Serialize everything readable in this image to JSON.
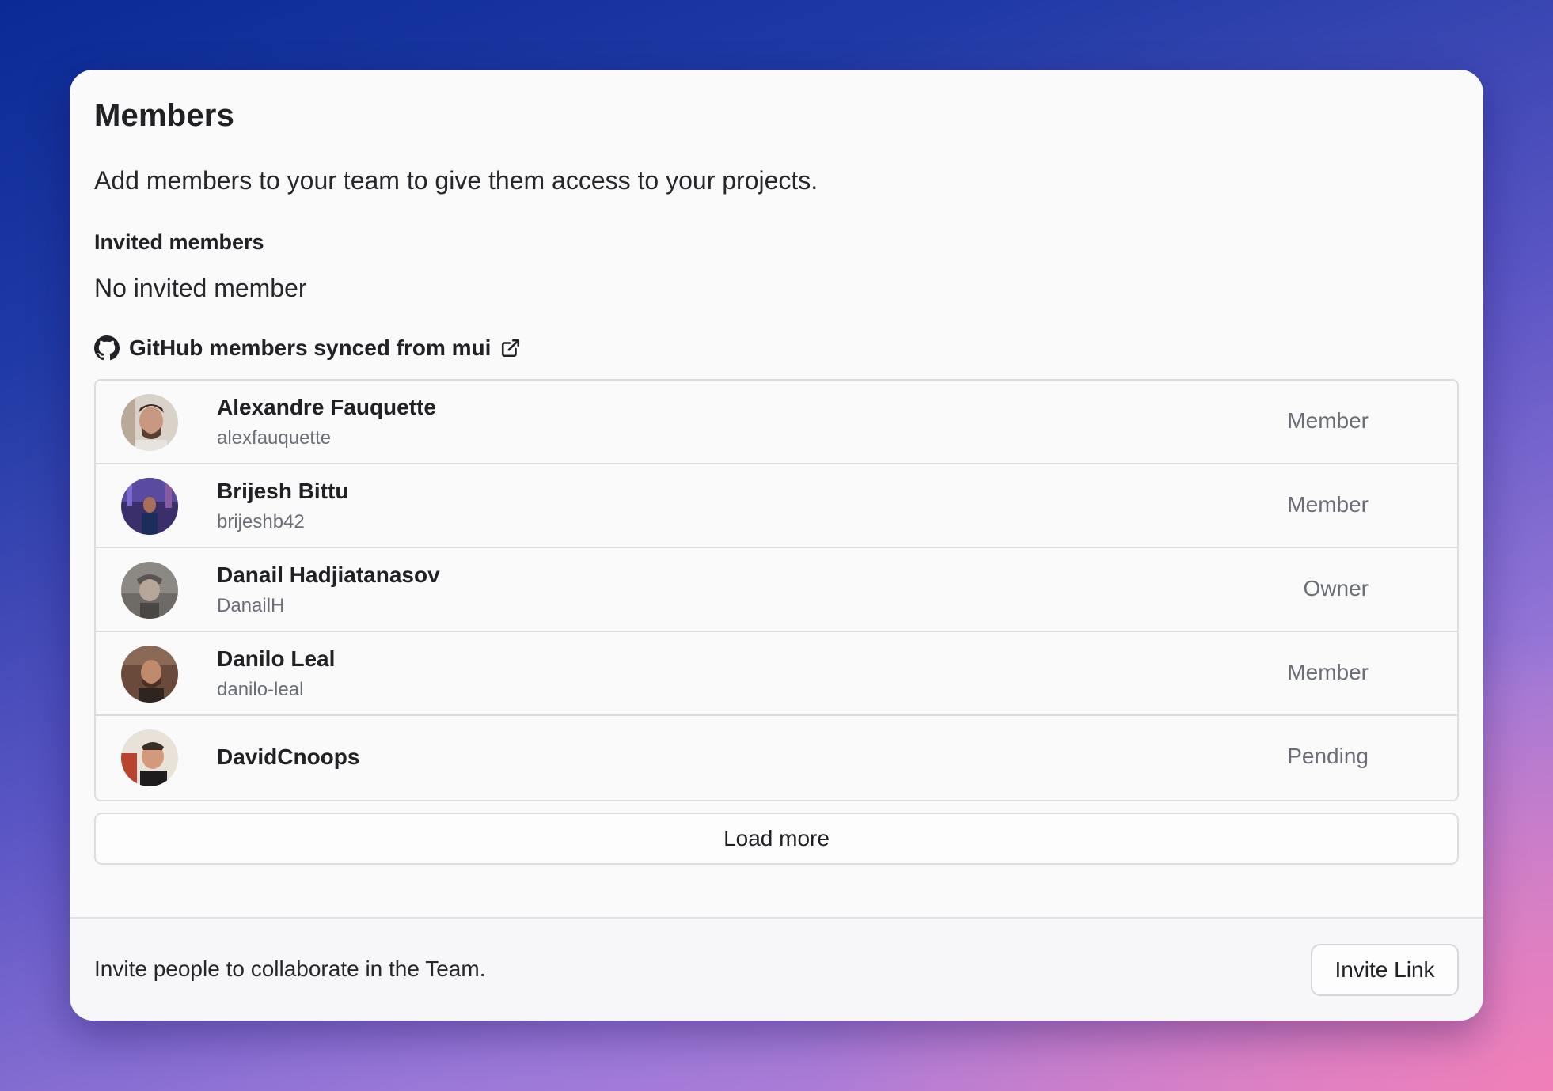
{
  "panel": {
    "title": "Members",
    "description": "Add members to your team to give them access to your projects."
  },
  "invited": {
    "label": "Invited members",
    "empty_text": "No invited member"
  },
  "github": {
    "label": "GitHub members synced from mui",
    "icon": "github-icon",
    "link_icon": "external-link-icon"
  },
  "members": [
    {
      "name": "Alexandre Fauquette",
      "login": "alexfauquette",
      "role": "Member"
    },
    {
      "name": "Brijesh Bittu",
      "login": "brijeshb42",
      "role": "Member"
    },
    {
      "name": "Danail Hadjiatanasov",
      "login": "DanailH",
      "role": "Owner"
    },
    {
      "name": "Danilo Leal",
      "login": "danilo-leal",
      "role": "Member"
    },
    {
      "name": "DavidCnoops",
      "login": "",
      "role": "Pending"
    }
  ],
  "load_more_label": "Load more",
  "footer": {
    "text": "Invite people to collaborate in the Team.",
    "invite_button_label": "Invite Link"
  }
}
